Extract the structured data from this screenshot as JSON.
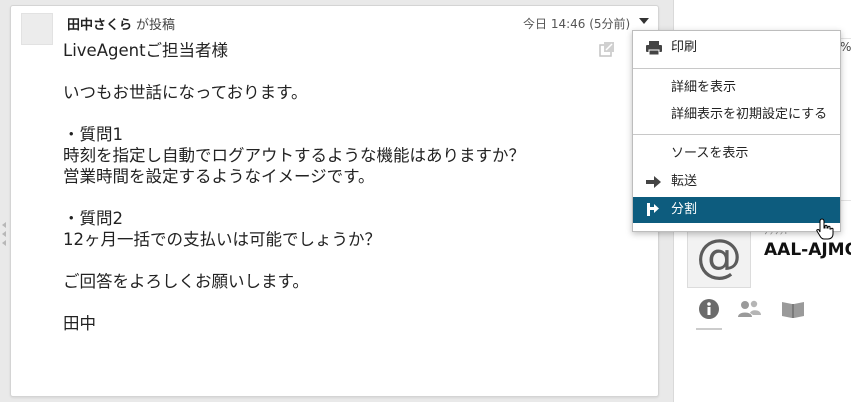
{
  "message": {
    "author_name": "田中さくら",
    "author_action": "が投稿",
    "timestamp": "今日 14:46 (5分前)",
    "body_lines": [
      "LiveAgentご担当者様",
      "",
      "いつもお世話になっております。",
      "",
      "・質問1",
      "時刻を指定し自動でログアウトするような機能はありますか？",
      "営業時間を設定するようなイメージです。",
      "",
      "・質問2",
      "12ヶ月一括での支払いは可能でしょうか？",
      "",
      "ご回答をよろしくお願いします。",
      "",
      "田中"
    ]
  },
  "context_menu": {
    "items": [
      {
        "label": "印刷",
        "icon": "printer-icon"
      },
      {
        "label": "詳細を表示",
        "icon": ""
      },
      {
        "label": "詳細表示を初期設定にする",
        "icon": ""
      },
      {
        "label": "ソースを表示",
        "icon": ""
      },
      {
        "label": "転送",
        "icon": "arrow-right-icon"
      },
      {
        "label": "分割",
        "icon": "split-icon",
        "active": true
      }
    ]
  },
  "side_panel": {
    "partial_text": "%",
    "contact_label": "ﾃｯﾘｯﾄ",
    "contact_name": "AAL-AJMO",
    "avatar_symbol": "@",
    "tab_icons": [
      "info-icon",
      "people-icon",
      "book-icon"
    ]
  },
  "colors": {
    "menu_active_bg": "#0d5c7e",
    "menu_active_fg": "#ffffff"
  }
}
